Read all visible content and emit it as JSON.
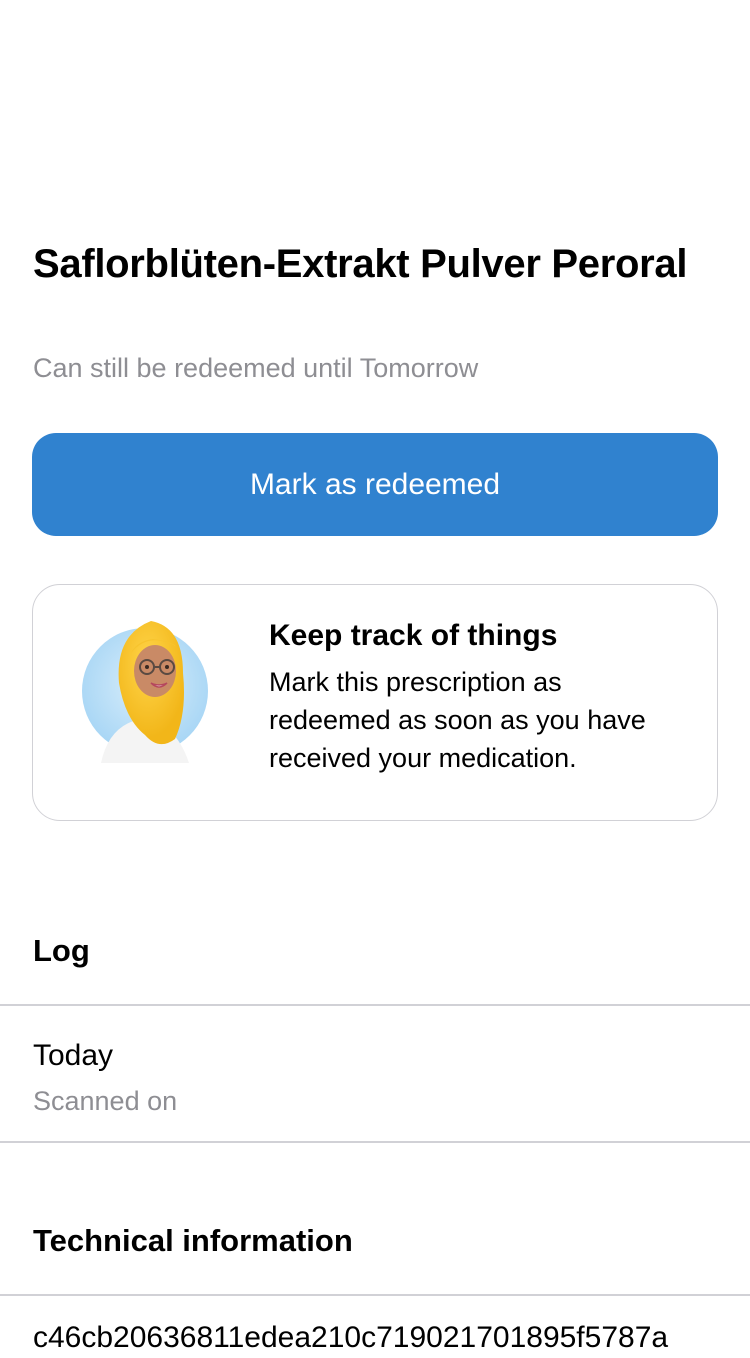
{
  "prescription": {
    "title": "Saflorblüten-Extrakt Pulver Peroral",
    "redeem_status": "Can still be redeemed until Tomorrow",
    "primary_action_label": "Mark as redeemed"
  },
  "hint": {
    "title": "Keep track of things",
    "text": "Mark this prescription as redeemed as soon as you have received your medication.",
    "avatar_icon": "doctor-avatar-icon"
  },
  "log": {
    "header": "Log",
    "entries": [
      {
        "date": "Today",
        "description": "Scanned on"
      }
    ]
  },
  "technical": {
    "header": "Technical information",
    "access_code": "c46cb20636811edea210c719021701895f5787a"
  },
  "colors": {
    "accent": "#3082cf",
    "secondary_text": "#8e8e93",
    "divider": "#d1d1d6"
  }
}
